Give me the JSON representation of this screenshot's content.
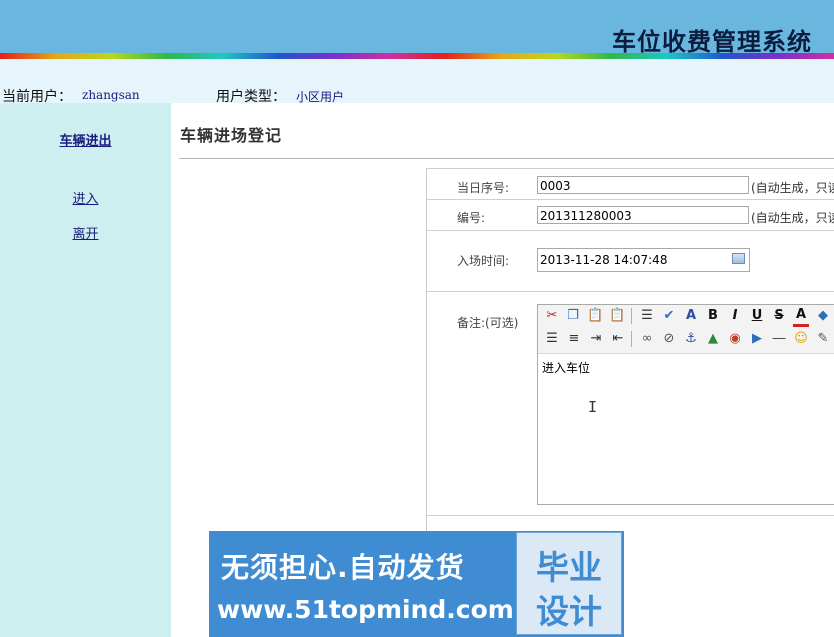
{
  "app": {
    "title": "车位收费管理系统"
  },
  "userbar": {
    "user_label": "当前用户：",
    "user_value": "zhangsan",
    "type_label": "用户类型：",
    "type_value": "小区用户"
  },
  "sidebar": {
    "heading": "车辆进出",
    "items": [
      {
        "label": "进入"
      },
      {
        "label": "离开"
      }
    ]
  },
  "main": {
    "page_title": "车辆进场登记",
    "form": {
      "daily_seq": {
        "label": "当日序号:",
        "value": "0003",
        "note": "(自动生成，只读"
      },
      "number": {
        "label": "编号:",
        "value": "201311280003",
        "note": "(自动生成，只读"
      },
      "entry_time": {
        "label": "入场时间:",
        "value": "2013-11-28 14:07:48"
      },
      "remark": {
        "label": "备注:(可选)",
        "content": "进入车位"
      }
    },
    "editor_toolbar": [
      "cut-icon",
      "copy-icon",
      "paste-icon",
      "paste-word-icon",
      "paste-text-icon",
      "spellcheck-icon",
      "font-style-icon",
      "bold-icon",
      "italic-icon",
      "underline-icon",
      "strikethrough-icon",
      "font-color-icon",
      "highlight-icon",
      "align-left-icon",
      "list-icon",
      "indent-icon",
      "outdent-icon",
      "link-icon",
      "unlink-icon",
      "anchor-icon",
      "image-icon",
      "flash-icon",
      "media-icon",
      "horizontal-rule-icon",
      "emoticon-icon",
      "edit-icon"
    ]
  },
  "banner": {
    "line1": "无须担心.自动发货",
    "line2": "www.51topmind.com",
    "box_line1": "毕业",
    "box_line2": "设计"
  },
  "colors": {
    "header_bg": "#69b7df",
    "sidebar_bg": "#cdeff0",
    "userbar_bg": "#e6f4fb",
    "banner_bg": "#3f8cd2",
    "link": "#1a1a7e"
  }
}
